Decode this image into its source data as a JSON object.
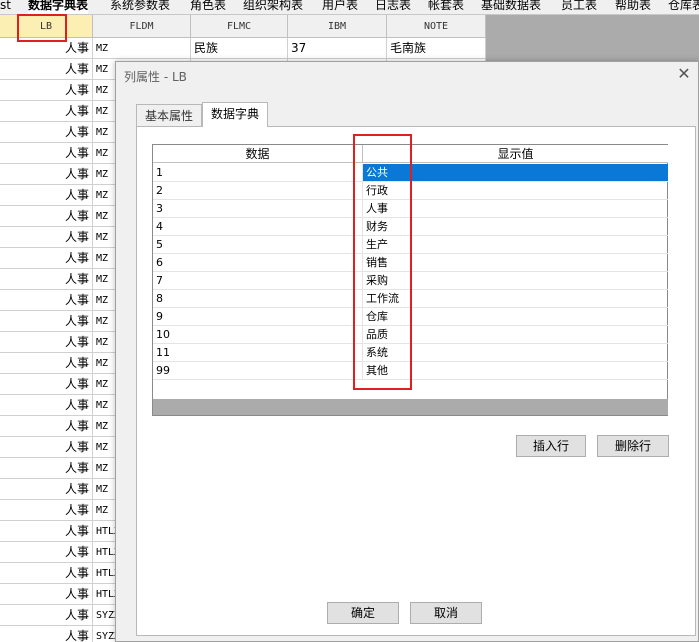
{
  "tabbar": {
    "tabs": [
      {
        "label": "st",
        "active": false
      },
      {
        "label": "数据字典表",
        "active": true
      },
      {
        "label": "系统参数表",
        "active": false
      },
      {
        "label": "角色表",
        "active": false
      },
      {
        "label": "组织架构表",
        "active": false
      },
      {
        "label": "用户表",
        "active": false
      },
      {
        "label": "日志表",
        "active": false
      },
      {
        "label": "帐套表",
        "active": false
      },
      {
        "label": "基础数据表",
        "active": false
      },
      {
        "label": "员工表",
        "active": false
      },
      {
        "label": "帮助表",
        "active": false
      },
      {
        "label": "仓库表",
        "active": false
      }
    ]
  },
  "grid": {
    "columns": [
      "LB",
      "FLDM",
      "FLMC",
      "IBM",
      "NOTE"
    ],
    "rows": [
      {
        "lb": "人事",
        "fldm": "MZ",
        "flmc": "民族",
        "ibm": "37",
        "note": "毛南族"
      },
      {
        "lb": "人事",
        "fldm": "MZ",
        "flmc": "",
        "ibm": "",
        "note": ""
      },
      {
        "lb": "人事",
        "fldm": "MZ",
        "flmc": "",
        "ibm": "",
        "note": ""
      },
      {
        "lb": "人事",
        "fldm": "MZ",
        "flmc": "",
        "ibm": "",
        "note": ""
      },
      {
        "lb": "人事",
        "fldm": "MZ",
        "flmc": "",
        "ibm": "",
        "note": ""
      },
      {
        "lb": "人事",
        "fldm": "MZ",
        "flmc": "",
        "ibm": "",
        "note": ""
      },
      {
        "lb": "人事",
        "fldm": "MZ",
        "flmc": "",
        "ibm": "",
        "note": ""
      },
      {
        "lb": "人事",
        "fldm": "MZ",
        "flmc": "",
        "ibm": "",
        "note": ""
      },
      {
        "lb": "人事",
        "fldm": "MZ",
        "flmc": "",
        "ibm": "",
        "note": ""
      },
      {
        "lb": "人事",
        "fldm": "MZ",
        "flmc": "",
        "ibm": "",
        "note": ""
      },
      {
        "lb": "人事",
        "fldm": "MZ",
        "flmc": "",
        "ibm": "",
        "note": ""
      },
      {
        "lb": "人事",
        "fldm": "MZ",
        "flmc": "",
        "ibm": "",
        "note": ""
      },
      {
        "lb": "人事",
        "fldm": "MZ",
        "flmc": "",
        "ibm": "",
        "note": ""
      },
      {
        "lb": "人事",
        "fldm": "MZ",
        "flmc": "",
        "ibm": "",
        "note": ""
      },
      {
        "lb": "人事",
        "fldm": "MZ",
        "flmc": "",
        "ibm": "",
        "note": ""
      },
      {
        "lb": "人事",
        "fldm": "MZ",
        "flmc": "",
        "ibm": "",
        "note": ""
      },
      {
        "lb": "人事",
        "fldm": "MZ",
        "flmc": "",
        "ibm": "",
        "note": ""
      },
      {
        "lb": "人事",
        "fldm": "MZ",
        "flmc": "",
        "ibm": "",
        "note": ""
      },
      {
        "lb": "人事",
        "fldm": "MZ",
        "flmc": "",
        "ibm": "",
        "note": ""
      },
      {
        "lb": "人事",
        "fldm": "MZ",
        "flmc": "",
        "ibm": "",
        "note": ""
      },
      {
        "lb": "人事",
        "fldm": "MZ",
        "flmc": "",
        "ibm": "",
        "note": ""
      },
      {
        "lb": "人事",
        "fldm": "MZ",
        "flmc": "",
        "ibm": "",
        "note": ""
      },
      {
        "lb": "人事",
        "fldm": "MZ",
        "flmc": "",
        "ibm": "",
        "note": ""
      },
      {
        "lb": "人事",
        "fldm": "HTLX",
        "flmc": "",
        "ibm": "",
        "note": ""
      },
      {
        "lb": "人事",
        "fldm": "HTLX",
        "flmc": "",
        "ibm": "",
        "note": ""
      },
      {
        "lb": "人事",
        "fldm": "HTLX",
        "flmc": "",
        "ibm": "",
        "note": ""
      },
      {
        "lb": "人事",
        "fldm": "HTLX",
        "flmc": "",
        "ibm": "",
        "note": ""
      },
      {
        "lb": "人事",
        "fldm": "SYZX",
        "flmc": "",
        "ibm": "",
        "note": ""
      },
      {
        "lb": "人事",
        "fldm": "SYZX",
        "flmc": "",
        "ibm": "",
        "note": ""
      },
      {
        "lb": "人事",
        "fldm": "SYZX",
        "flmc": "",
        "ibm": "",
        "note": ""
      }
    ]
  },
  "dialog": {
    "title": "列属性 - LB",
    "close_icon": "close-icon",
    "tabs": [
      {
        "label": "基本属性",
        "active": false
      },
      {
        "label": "数据字典",
        "active": true
      }
    ],
    "dict": {
      "headers": [
        "数据",
        "显示值"
      ],
      "rows": [
        {
          "value": "1",
          "display": "公共"
        },
        {
          "value": "2",
          "display": "行政"
        },
        {
          "value": "3",
          "display": "人事"
        },
        {
          "value": "4",
          "display": "财务"
        },
        {
          "value": "5",
          "display": "生产"
        },
        {
          "value": "6",
          "display": "销售"
        },
        {
          "value": "7",
          "display": "采购"
        },
        {
          "value": "8",
          "display": "工作流"
        },
        {
          "value": "9",
          "display": "仓库"
        },
        {
          "value": "10",
          "display": "品质"
        },
        {
          "value": "11",
          "display": "系统"
        },
        {
          "value": "99",
          "display": "其他"
        }
      ],
      "selected_index": 0
    },
    "buttons": {
      "insert_row": "插入行",
      "delete_row": "删除行",
      "ok": "确定",
      "cancel": "取消"
    }
  },
  "colors": {
    "highlight_red": "#e02020",
    "selection_blue": "#0a78d7",
    "header_yellow": "#fcefb4"
  }
}
